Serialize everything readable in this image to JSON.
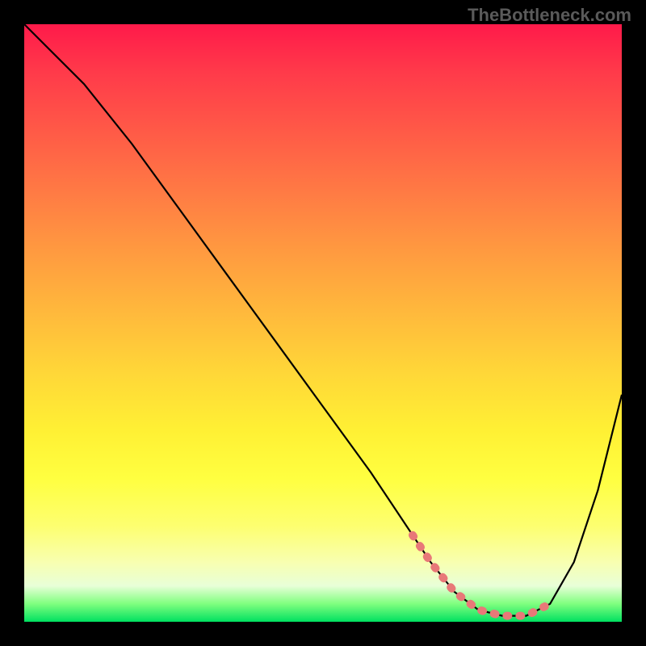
{
  "watermark": "TheBottleneck.com",
  "chart_data": {
    "type": "line",
    "title": "",
    "xlabel": "",
    "ylabel": "",
    "xlim": [
      0,
      100
    ],
    "ylim": [
      0,
      100
    ],
    "grid": false,
    "legend": false,
    "series": [
      {
        "name": "curve",
        "x": [
          0,
          4,
          10,
          18,
          26,
          34,
          42,
          50,
          58,
          64,
          68,
          72,
          76,
          80,
          84,
          88,
          92,
          96,
          100
        ],
        "y": [
          100,
          96,
          90,
          80,
          69,
          58,
          47,
          36,
          25,
          16,
          10,
          5,
          2,
          1,
          1,
          3,
          10,
          22,
          38
        ]
      }
    ],
    "highlight_range_x": [
      65,
      88
    ],
    "accent_color": "#e87878"
  }
}
